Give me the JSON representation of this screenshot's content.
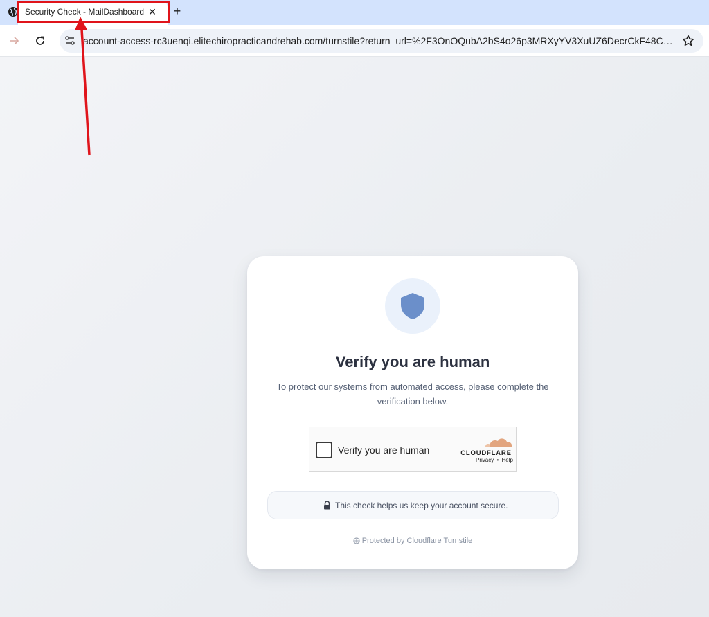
{
  "browser": {
    "tab": {
      "title": "Security Check - MailDashboard",
      "close_glyph": "✕"
    },
    "new_tab_glyph": "+",
    "url": "account-access-rc3uenqi.elitechiropracticandrehab.com/turnstile?return_url=%2F3OnOQubA2bS4o26p3MRXyYV3XuUZ6DecrCkF48CXx5..."
  },
  "card": {
    "title": "Verify you are human",
    "subtitle": "To protect our systems from automated access, please complete the verification below.",
    "widget": {
      "label": "Verify you are human",
      "brand": "CLOUDFLARE",
      "privacy": "Privacy",
      "separator": "•",
      "help": "Help"
    },
    "secure_note": "This check helps us keep your account secure.",
    "footer": "Protected by Cloudflare Turnstile"
  },
  "colors": {
    "annotation": "#e0141b",
    "shield": "#6b8fca",
    "cloudflare_orange": "#e2a57f"
  }
}
